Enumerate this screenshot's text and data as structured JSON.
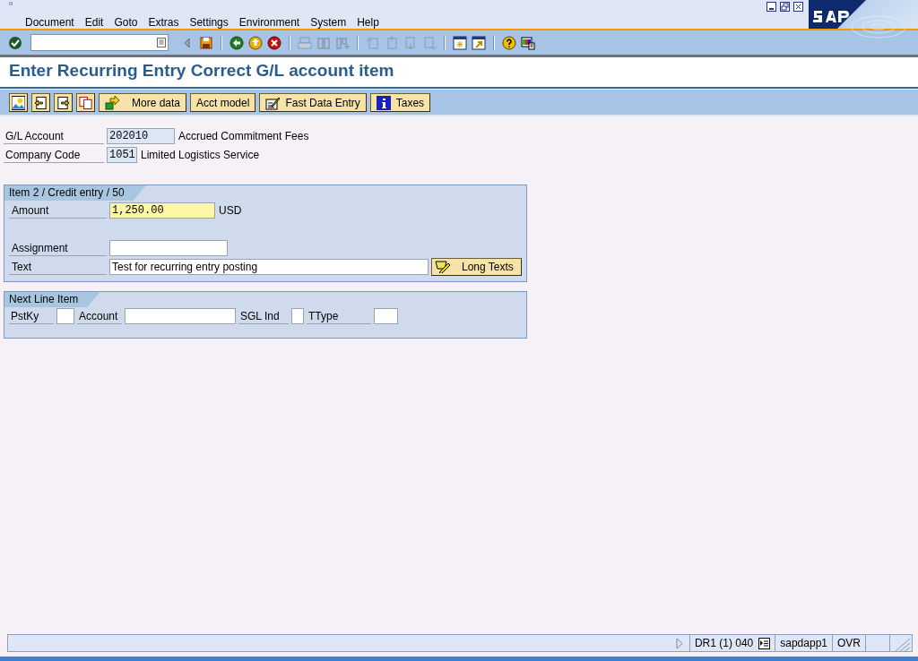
{
  "window": {
    "title": "Enter Recurring Entry Correct G/L account item"
  },
  "menu": [
    "Document",
    "Edit",
    "Goto",
    "Extras",
    "Settings",
    "Environment",
    "System",
    "Help"
  ],
  "app_buttons": [
    {
      "label": "More data",
      "kind": "arrow"
    },
    {
      "label": "Acct model",
      "kind": "text"
    },
    {
      "label": "Fast Data Entry",
      "kind": "pencil"
    },
    {
      "label": "Taxes",
      "kind": "info"
    }
  ],
  "header_fields": [
    {
      "label": "G/L Account",
      "value": "202010",
      "description": "Accrued Commitment Fees"
    },
    {
      "label": "Company Code",
      "value": "1051",
      "description": "Limited Logistics Service"
    }
  ],
  "item_group": {
    "title": "Item 2 / Credit entry / 50",
    "amount": {
      "label": "Amount",
      "value": "1,250.00",
      "currency": "USD"
    },
    "assignment": {
      "label": "Assignment"
    },
    "text": {
      "label": "Text",
      "value": "Test for recurring entry posting"
    },
    "long_texts_button": "Long Texts"
  },
  "next_line_item": {
    "title": "Next Line Item",
    "fields": [
      {
        "label": "PstKy"
      },
      {
        "label": "Account"
      },
      {
        "label": "SGL Ind"
      },
      {
        "label": "TType"
      }
    ]
  },
  "status_bar": {
    "system": "DR1 (1) 040",
    "server": "sapdapp1",
    "mode": "OVR"
  }
}
